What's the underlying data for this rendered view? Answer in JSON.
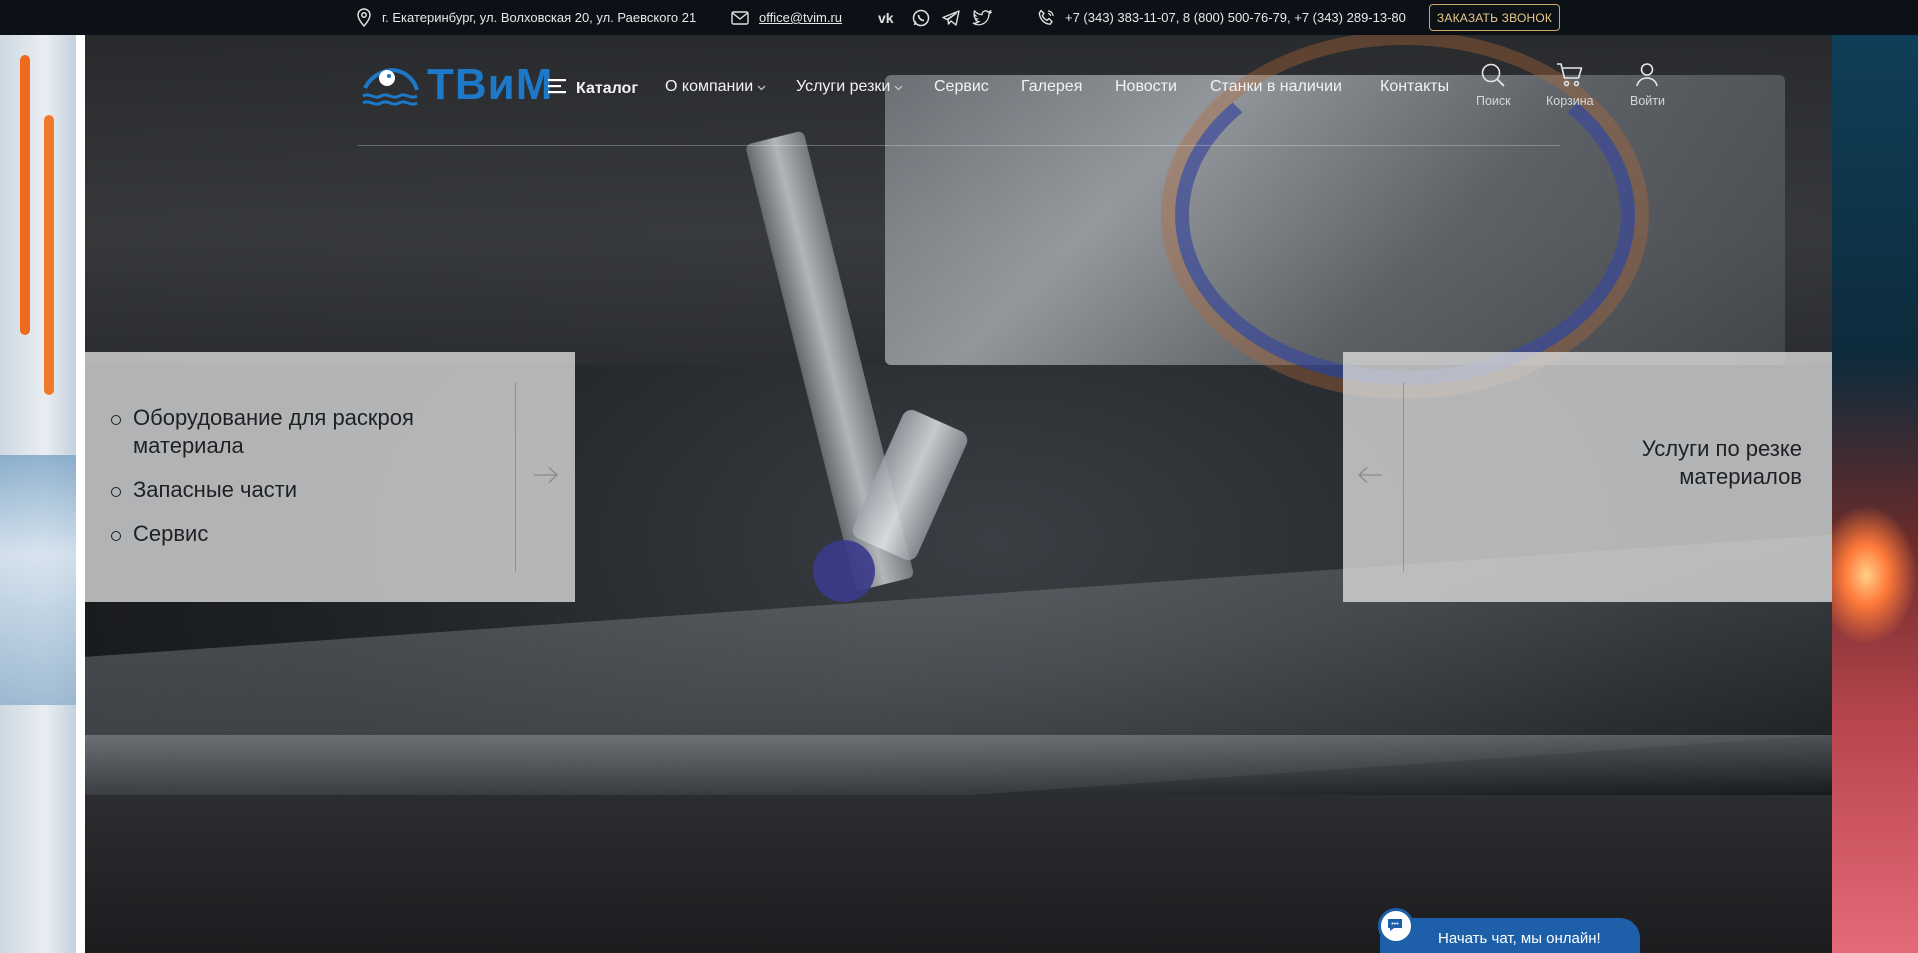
{
  "topbar": {
    "address": "г. Екатеринбург, ул. Волховская 20, ул. Раевского 21",
    "email": "office@tvim.ru",
    "phones": "+7 (343) 383-11-07, 8 (800) 500-76-79, +7 (343) 289-13-80",
    "callback_label": "ЗАКАЗАТЬ ЗВОНОК",
    "icons": [
      "map-pin-icon",
      "mail-icon",
      "vk-icon",
      "whatsapp-icon",
      "telegram-icon",
      "twitter-icon",
      "phone-icon"
    ]
  },
  "header": {
    "logo_text": "ТВиМ",
    "nav": [
      {
        "label": "Каталог"
      },
      {
        "label": "О компании"
      },
      {
        "label": "Услуги резки"
      },
      {
        "label": "Сервис"
      },
      {
        "label": "Галерея"
      },
      {
        "label": "Новости"
      },
      {
        "label": "Станки в наличии"
      },
      {
        "label": "Контакты"
      }
    ],
    "search_label": "Поиск",
    "cart_label": "Корзина",
    "login_label": "Войти"
  },
  "slider": {
    "left_items": [
      "Оборудование для раскроя материала",
      "Запасные части",
      "Сервис"
    ],
    "right_title": "Услуги по резке материалов"
  },
  "chat": {
    "label": "Начать чат, мы онлайн!"
  },
  "colors": {
    "topbar_bg": "#0c1117",
    "callback_border": "#c9a86a",
    "logo_blue": "#1e78c8",
    "chat_blue": "#1d5fa8"
  }
}
